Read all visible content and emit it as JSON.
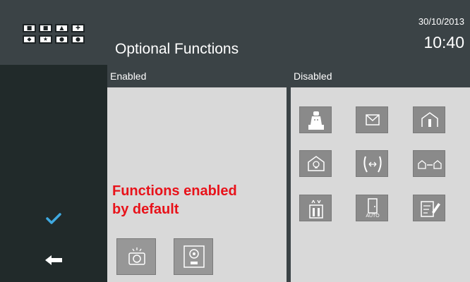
{
  "header": {
    "title": "Optional Functions",
    "date": "30/10/2013",
    "time": "10:40"
  },
  "columns": {
    "enabled_label": "Enabled",
    "disabled_label": "Disabled"
  },
  "annotation": {
    "line1": "Functions enabled",
    "line2": "by default"
  },
  "disabled_tiles": [
    {
      "icon": "concierge-icon"
    },
    {
      "icon": "message-icon"
    },
    {
      "icon": "home-icon"
    },
    {
      "icon": "home-automation-icon"
    },
    {
      "icon": "intercom-transfer-icon"
    },
    {
      "icon": "house-to-house-icon"
    },
    {
      "icon": "lift-icon"
    },
    {
      "icon": "door-auto-icon",
      "label": "AUTO"
    },
    {
      "icon": "notes-icon"
    }
  ],
  "enabled_tiles": [
    {
      "icon": "camera-icon"
    },
    {
      "icon": "door-panel-icon"
    }
  ],
  "sidebar": {
    "confirm_icon": "check-icon",
    "back_icon": "back-arrow-icon"
  },
  "colors": {
    "accent": "#3fa9e0",
    "annotation": "#e8121a",
    "header": "#3b4346",
    "panel": "#d9d9d9"
  }
}
